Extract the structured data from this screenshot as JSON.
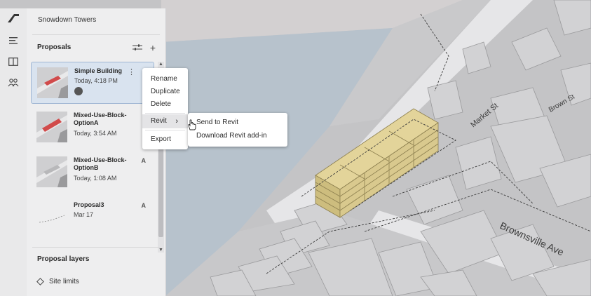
{
  "project": {
    "title": "Snowdown Towers"
  },
  "rail": {
    "icons": [
      "app-logo-icon",
      "list-icon",
      "book-icon",
      "people-icon"
    ]
  },
  "proposals": {
    "section_title": "Proposals",
    "items": [
      {
        "name": "Simple Building",
        "date": "Today, 4:18 PM",
        "badge": "",
        "selected": true
      },
      {
        "name": "Mixed-Use-Block-OptionA",
        "date": "Today, 3:54 AM",
        "badge": ""
      },
      {
        "name": "Mixed-Use-Block-OptionB",
        "date": "Today, 1:08 AM",
        "badge": "A"
      },
      {
        "name": "Proposal3",
        "date": "Mar 17",
        "badge": "A"
      }
    ]
  },
  "context_menu": {
    "rename": "Rename",
    "duplicate": "Duplicate",
    "delete": "Delete",
    "revit": "Revit",
    "export": "Export"
  },
  "revit_submenu": {
    "send": "Send to Revit",
    "download": "Download Revit add-in"
  },
  "layers": {
    "section_title": "Proposal layers",
    "items": [
      {
        "label": "Site limits"
      }
    ]
  },
  "map": {
    "streets": [
      "Market St",
      "Brownsville Ave",
      "Brown St"
    ],
    "colors": {
      "building": "#cfcfd1",
      "highlight": "#d9c98e",
      "water": "#b7c2cc",
      "road": "#e6e6e8"
    }
  }
}
